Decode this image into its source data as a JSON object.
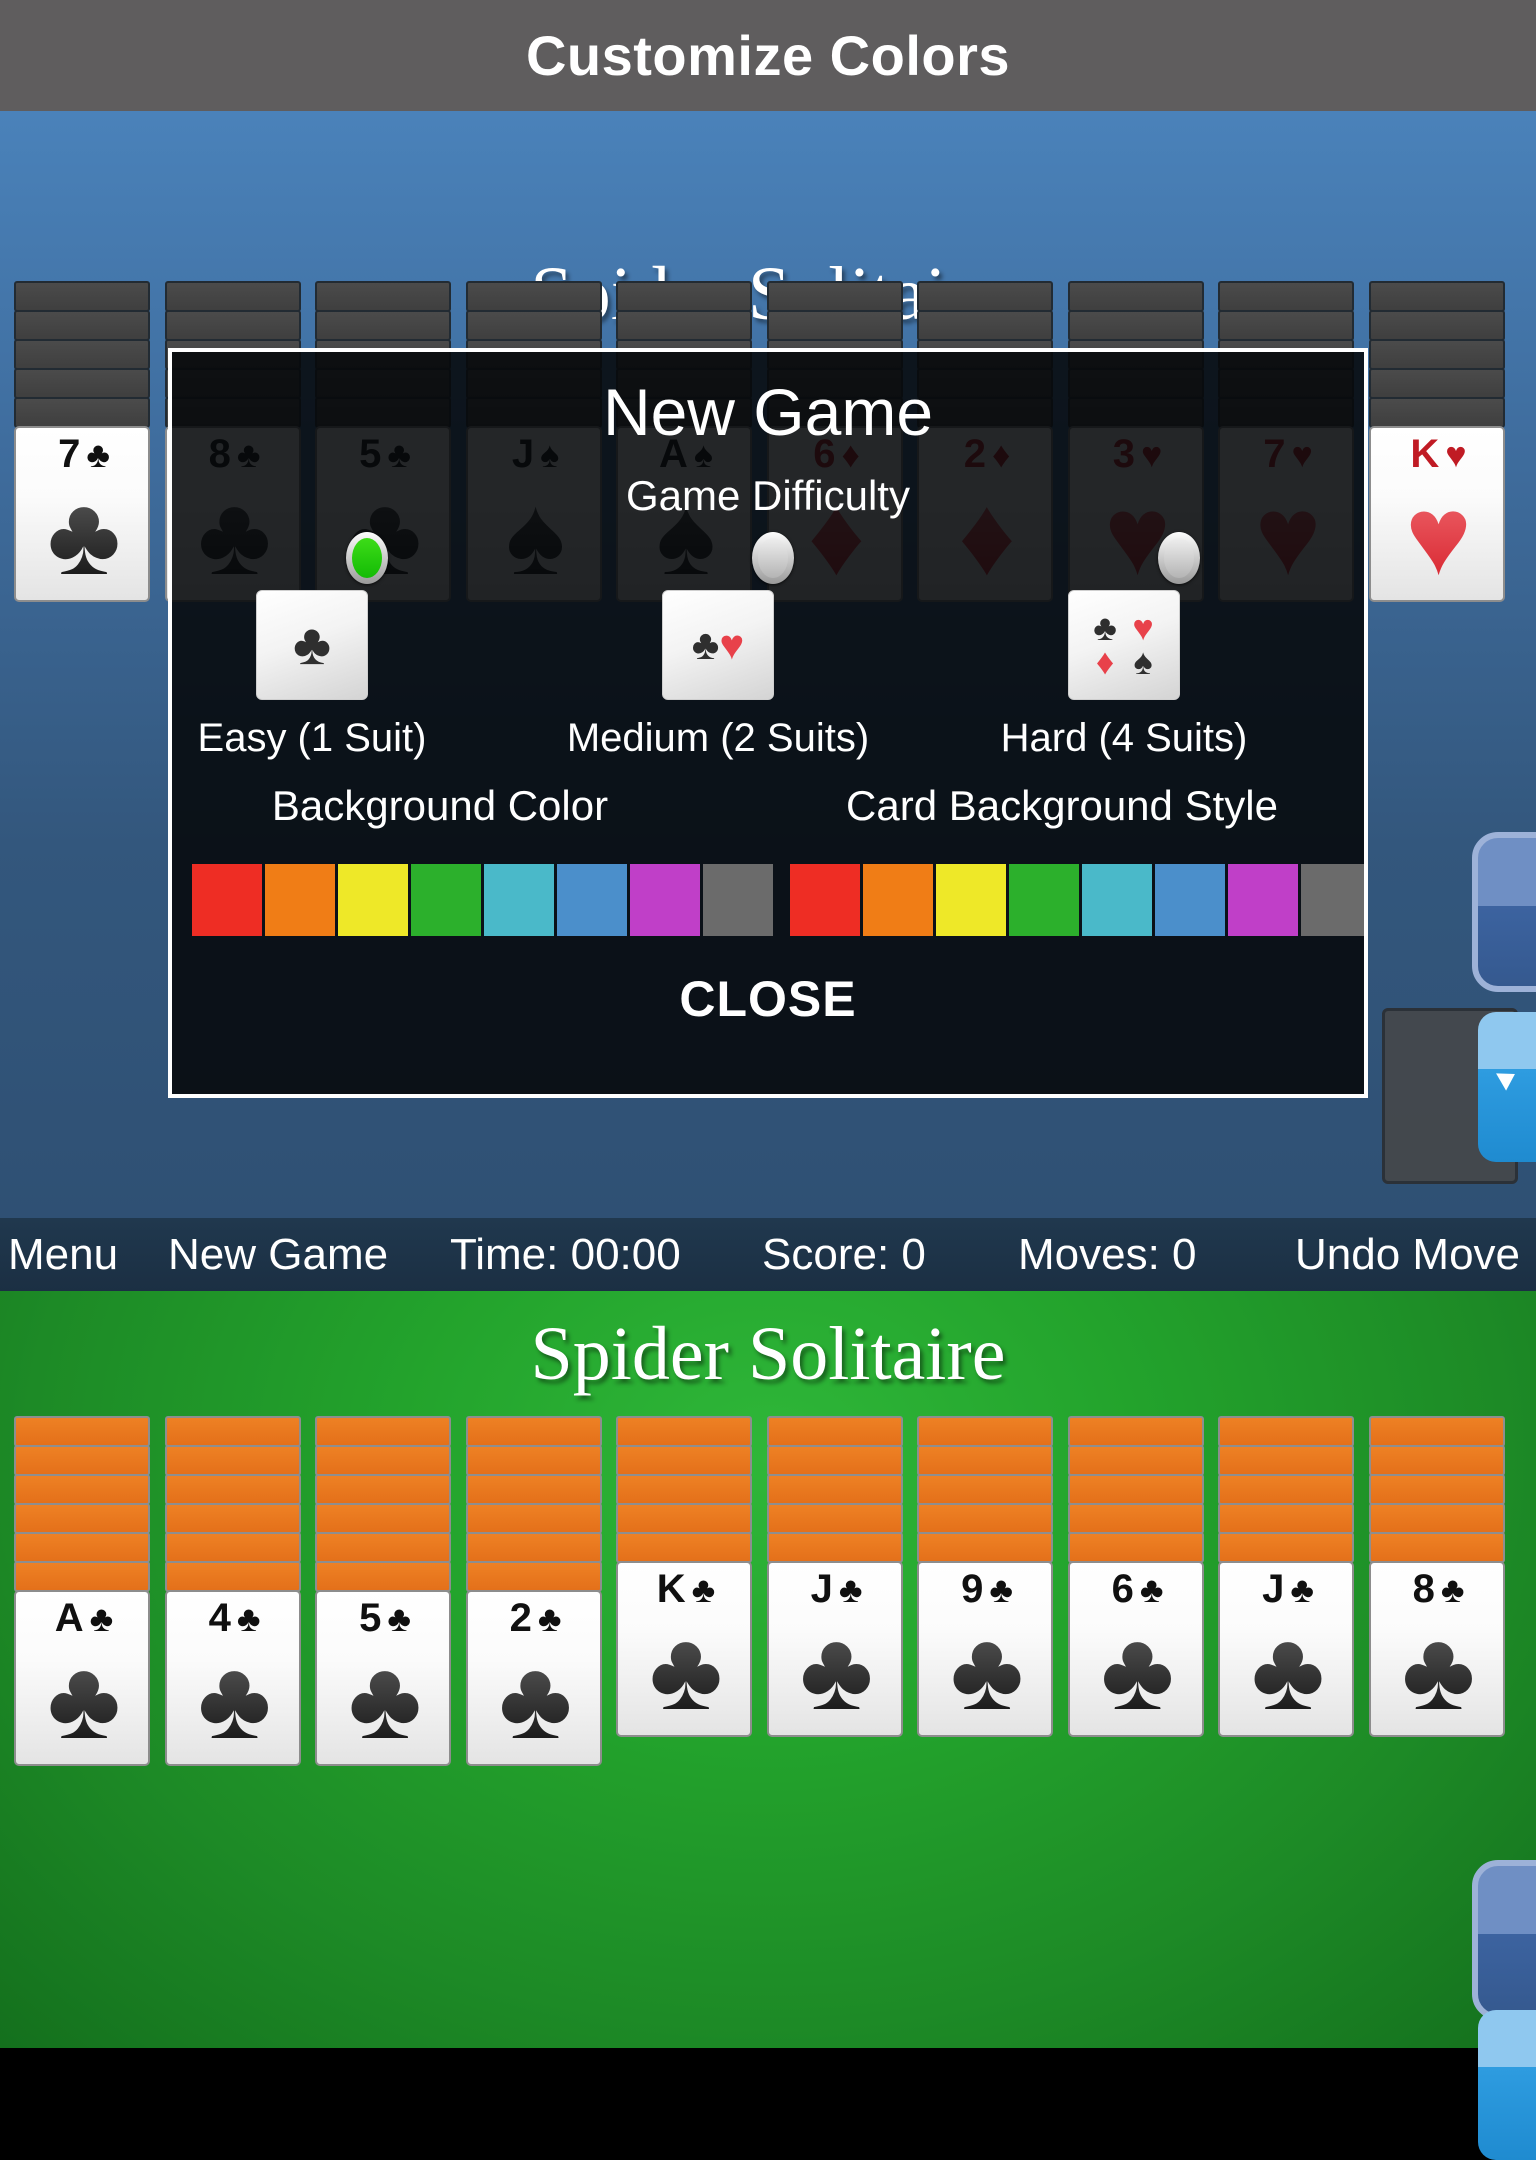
{
  "titlebar": {
    "label": "Customize Colors"
  },
  "upper_game": {
    "title": "Spider Solitaire",
    "background_color": "#3f6d9e",
    "card_back_color": "#454545",
    "columns": [
      {
        "backs": 5,
        "face": {
          "rank": "7",
          "suit": "♣",
          "color": "black"
        }
      },
      {
        "backs": 5,
        "face": {
          "rank": "8",
          "suit": "♣",
          "color": "black"
        }
      },
      {
        "backs": 5,
        "face": {
          "rank": "5",
          "suit": "♣",
          "color": "black"
        }
      },
      {
        "backs": 5,
        "face": {
          "rank": "J",
          "suit": "♠",
          "color": "black"
        }
      },
      {
        "backs": 5,
        "face": {
          "rank": "A",
          "suit": "♠",
          "color": "black"
        }
      },
      {
        "backs": 5,
        "face": {
          "rank": "6",
          "suit": "♦",
          "color": "red"
        }
      },
      {
        "backs": 5,
        "face": {
          "rank": "2",
          "suit": "♦",
          "color": "red"
        }
      },
      {
        "backs": 5,
        "face": {
          "rank": "3",
          "suit": "♥",
          "color": "red"
        }
      },
      {
        "backs": 5,
        "face": {
          "rank": "7",
          "suit": "♥",
          "color": "red"
        }
      },
      {
        "backs": 5,
        "face": {
          "rank": "K",
          "suit": "♥",
          "color": "red"
        }
      }
    ]
  },
  "dialog": {
    "title": "New Game",
    "difficulty_heading": "Game Difficulty",
    "difficulties": [
      {
        "label": "Easy (1 Suit)",
        "selected": true,
        "suits": [
          "♣"
        ]
      },
      {
        "label": "Medium (2 Suits)",
        "selected": false,
        "suits": [
          "♣",
          "♥"
        ]
      },
      {
        "label": "Hard (4 Suits)",
        "selected": false,
        "suits": [
          "♣",
          "♥",
          "♦",
          "♠"
        ]
      }
    ],
    "background_color_heading": "Background Color",
    "card_background_style_heading": "Card Background Style",
    "background_color_swatches": [
      "#ee2d24",
      "#f07d16",
      "#eee828",
      "#2cb02c",
      "#4ab9c9",
      "#4b8fcb",
      "#c03fc8",
      "#6b6b6b"
    ],
    "card_background_swatches": [
      "#ee2d24",
      "#f07d16",
      "#eee828",
      "#2cb02c",
      "#4ab9c9",
      "#4b8fcb",
      "#c03fc8",
      "#6b6b6b"
    ],
    "close_label": "CLOSE"
  },
  "toolbar": {
    "menu": "Menu",
    "new_game": "New Game",
    "time": "Time: 00:00",
    "score": "Score: 0",
    "moves": "Moves: 0",
    "undo": "Undo Move"
  },
  "lower_game": {
    "title": "Spider Solitaire",
    "background_color": "#23a32c",
    "card_back_color": "#e4701a",
    "columns": [
      {
        "backs": 6,
        "face": {
          "rank": "A",
          "suit": "♣",
          "color": "black"
        }
      },
      {
        "backs": 6,
        "face": {
          "rank": "4",
          "suit": "♣",
          "color": "black"
        }
      },
      {
        "backs": 6,
        "face": {
          "rank": "5",
          "suit": "♣",
          "color": "black"
        }
      },
      {
        "backs": 6,
        "face": {
          "rank": "2",
          "suit": "♣",
          "color": "black"
        }
      },
      {
        "backs": 5,
        "face": {
          "rank": "K",
          "suit": "♣",
          "color": "black"
        }
      },
      {
        "backs": 5,
        "face": {
          "rank": "J",
          "suit": "♣",
          "color": "black"
        }
      },
      {
        "backs": 5,
        "face": {
          "rank": "9",
          "suit": "♣",
          "color": "black"
        }
      },
      {
        "backs": 5,
        "face": {
          "rank": "6",
          "suit": "♣",
          "color": "black"
        }
      },
      {
        "backs": 5,
        "face": {
          "rank": "J",
          "suit": "♣",
          "color": "black"
        }
      },
      {
        "backs": 5,
        "face": {
          "rank": "8",
          "suit": "♣",
          "color": "black"
        }
      }
    ]
  }
}
